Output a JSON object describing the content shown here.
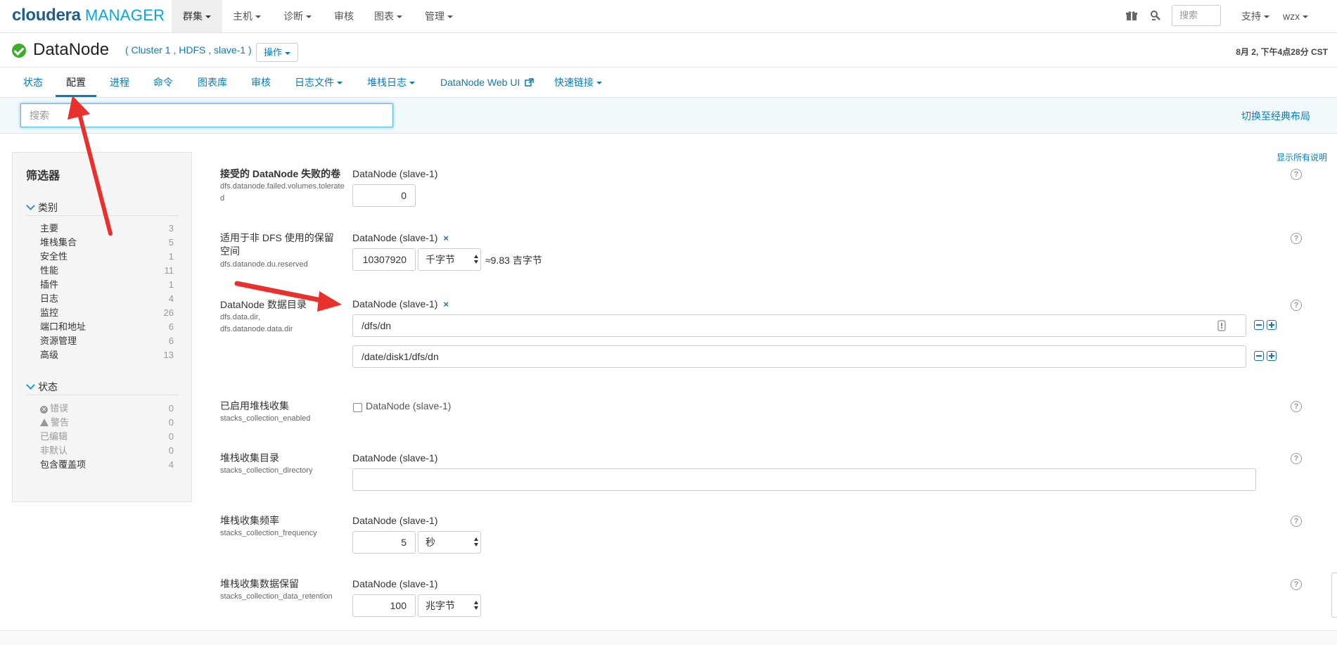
{
  "brand": {
    "name": "cloudera",
    "product": "MANAGER"
  },
  "topnav": {
    "items": [
      {
        "label": "群集",
        "active": true,
        "dropdown": true
      },
      {
        "label": "主机",
        "dropdown": true
      },
      {
        "label": "诊断",
        "dropdown": true
      },
      {
        "label": "审核",
        "dropdown": false
      },
      {
        "label": "图表",
        "dropdown": true
      },
      {
        "label": "管理",
        "dropdown": true
      }
    ],
    "search_placeholder": "搜索",
    "support": "支持",
    "user": "wzx"
  },
  "header": {
    "title": "DataNode",
    "breadcrumb": "( Cluster 1 , HDFS , slave-1 )",
    "actions": "操作",
    "timestamp": "8月 2, 下午4点28分 CST",
    "status_color": "#3dac2c"
  },
  "tabs": [
    "状态",
    "配置",
    "进程",
    "命令",
    "图表库",
    "审核",
    "日志文件",
    "堆栈日志",
    "DataNode Web UI",
    "快速链接"
  ],
  "active_tab": "配置",
  "search": {
    "placeholder": "搜索",
    "classic_link": "切换至经典布局"
  },
  "filter": {
    "title": "筛选器",
    "category_title": "类别",
    "categories": [
      {
        "label": "主要",
        "count": "3"
      },
      {
        "label": "堆栈集合",
        "count": "5"
      },
      {
        "label": "安全性",
        "count": "1"
      },
      {
        "label": "性能",
        "count": "11"
      },
      {
        "label": "插件",
        "count": "1"
      },
      {
        "label": "日志",
        "count": "4"
      },
      {
        "label": "监控",
        "count": "26"
      },
      {
        "label": "端口和地址",
        "count": "6"
      },
      {
        "label": "资源管理",
        "count": "6"
      },
      {
        "label": "高级",
        "count": "13"
      }
    ],
    "status_title": "状态",
    "statuses": [
      {
        "label": "错误",
        "count": "0"
      },
      {
        "label": "警告",
        "count": "0"
      },
      {
        "label": "已编辑",
        "count": "0"
      },
      {
        "label": "非默认",
        "count": "0"
      },
      {
        "label": "包含覆盖项",
        "count": "4"
      }
    ]
  },
  "show_all_desc": "显示所有说明",
  "configs": {
    "failed_volumes": {
      "label": "接受的 DataNode 失败的卷",
      "key": "dfs.datanode.failed.volumes.tolerated",
      "scope": "DataNode (slave-1)",
      "value": "0"
    },
    "du_reserved": {
      "label": "适用于非 DFS 使用的保留空间",
      "key": "dfs.datanode.du.reserved",
      "scope": "DataNode (slave-1)",
      "value": "10307920",
      "unit": "千字节",
      "approx": "≈9.83 吉字节"
    },
    "data_dir": {
      "label": "DataNode 数据目录",
      "key1": "dfs.data.dir,",
      "key2": "dfs.datanode.data.dir",
      "scope": "DataNode (slave-1)",
      "values": [
        "/dfs/dn",
        "/date/disk1/dfs/dn"
      ]
    },
    "stacks_enabled": {
      "label": "已启用堆栈收集",
      "key": "stacks_collection_enabled",
      "scope": "DataNode (slave-1)",
      "checked": false
    },
    "stacks_dir": {
      "label": "堆栈收集目录",
      "key": "stacks_collection_directory",
      "scope": "DataNode (slave-1)",
      "value": ""
    },
    "stacks_freq": {
      "label": "堆栈收集频率",
      "key": "stacks_collection_frequency",
      "scope": "DataNode (slave-1)",
      "value": "5",
      "unit": "秒"
    },
    "stacks_retention": {
      "label": "堆栈收集数据保留",
      "key": "stacks_collection_data_retention",
      "scope": "DataNode (slave-1)",
      "value": "100",
      "unit": "兆字节"
    }
  },
  "remove_mark": "×",
  "help_mark": "?",
  "arrow_color": "#e8302c"
}
